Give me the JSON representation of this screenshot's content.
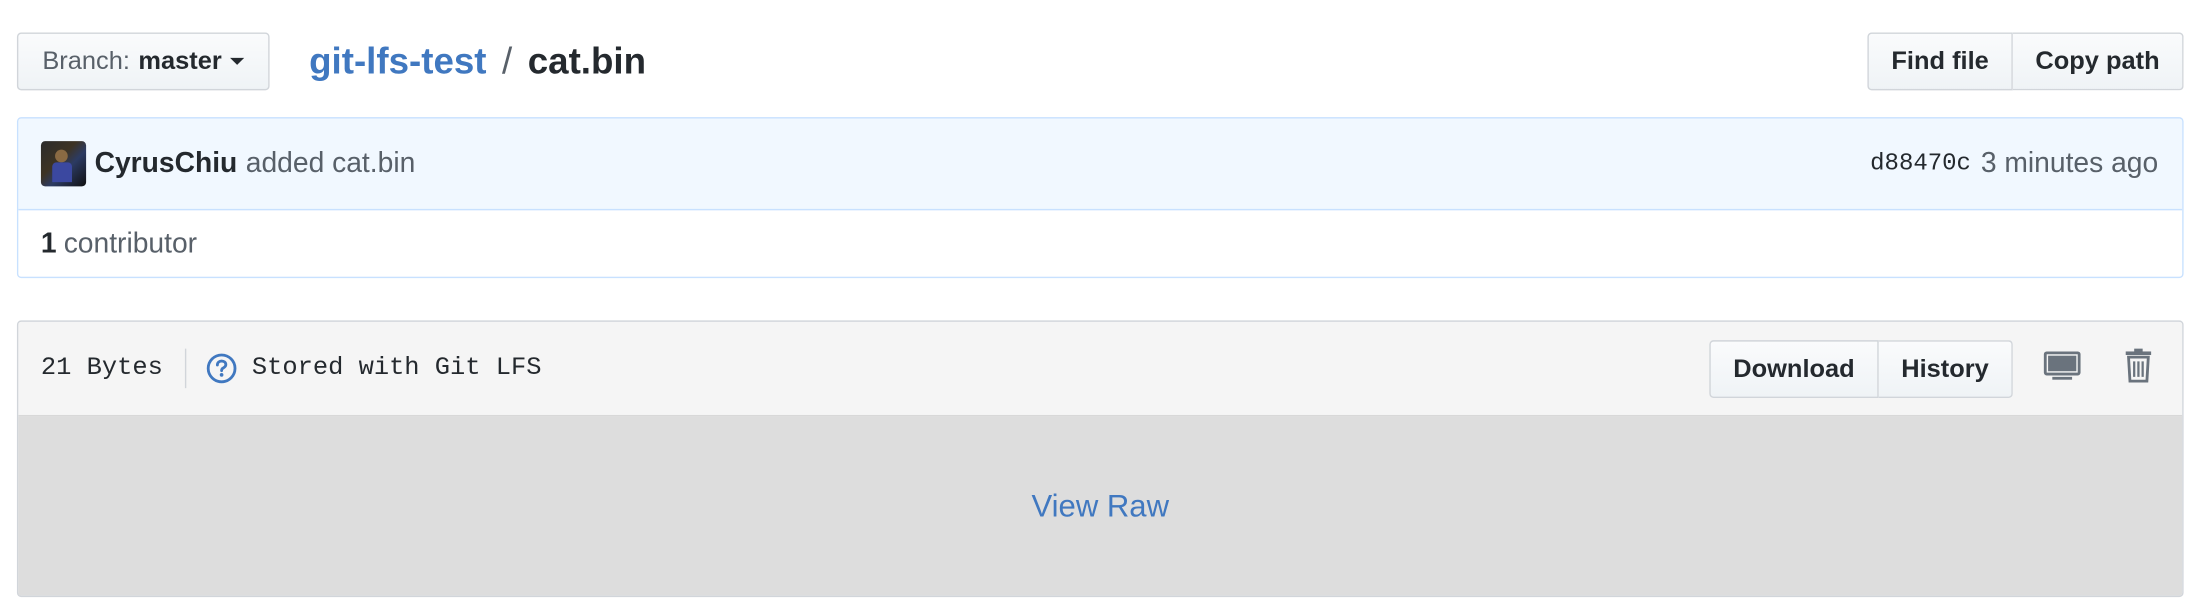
{
  "file_nav": {
    "branch_prefix": "Branch:",
    "branch_name": "master",
    "repo_name": "git-lfs-test",
    "separator": "/",
    "file_name": "cat.bin",
    "find_file_label": "Find file",
    "copy_path_label": "Copy path"
  },
  "commit": {
    "author": "CyrusChiu",
    "message": "added cat.bin",
    "sha": "d88470c",
    "time_ago": "3 minutes ago"
  },
  "contributors": {
    "count": "1",
    "label": "contributor"
  },
  "file": {
    "size": "21 Bytes",
    "lfs_label": "Stored with Git LFS",
    "download_label": "Download",
    "history_label": "History",
    "view_raw_label": "View Raw"
  },
  "colors": {
    "link": "#4078c0",
    "commit_bg": "#f1f8ff",
    "commit_border": "#c8e1ff",
    "blob_bg": "#dddddd"
  },
  "icons": {
    "branch_caret": "chevron-down-icon",
    "lfs_help": "question-circle-icon",
    "open_desktop": "desktop-icon",
    "delete": "trash-icon"
  }
}
